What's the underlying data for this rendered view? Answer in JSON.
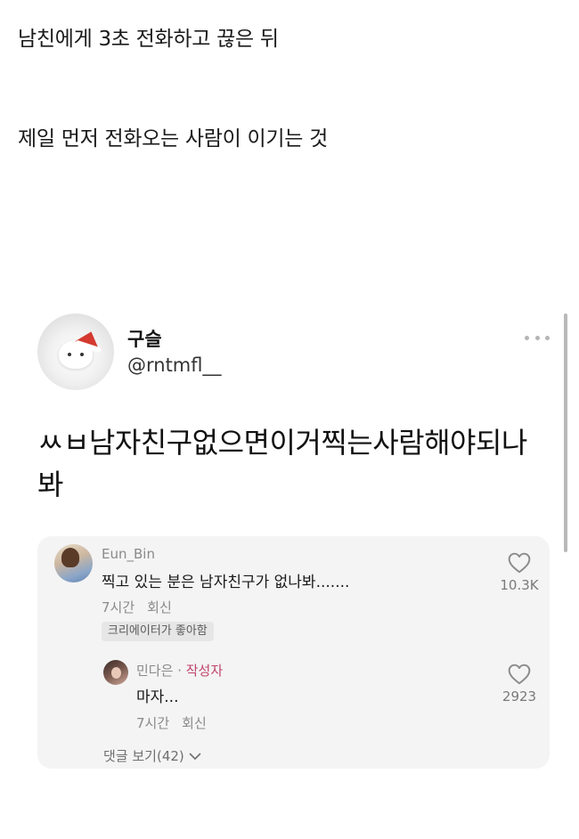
{
  "caption": {
    "line1": "남친에게 3초 전화하고 끊은 뒤",
    "line2": "제일 먼저 전화오는 사람이 이기는 것"
  },
  "post": {
    "author": {
      "name": "구슬",
      "handle": "@rntmfl__",
      "avatar_icon": "santa-hat-bear-avatar"
    },
    "more_icon": "more-horizontal-icon",
    "text": "ㅆㅂ남자친구없으면이거찍는사람해야되나봐"
  },
  "comments": [
    {
      "username": "Eun_Bin",
      "text": "찍고 있는 분은 남자친구가 없나봐.......",
      "time": "7시간",
      "reply_label": "회신",
      "creator_liked_badge": "크리에이터가 좋아함",
      "likes": "10.3K",
      "avatar_icon": "user-avatar"
    },
    {
      "username": "민다은",
      "separator": "·",
      "author_tag": "작성자",
      "text": "마자...",
      "time": "7시간",
      "reply_label": "회신",
      "likes": "2923",
      "avatar_icon": "user-avatar"
    }
  ],
  "view_replies": "댓글 보기(42)",
  "colors": {
    "author_tag": "#c0456b",
    "panel_bg": "#f4f4f4",
    "muted_text": "#8a8a8a"
  }
}
